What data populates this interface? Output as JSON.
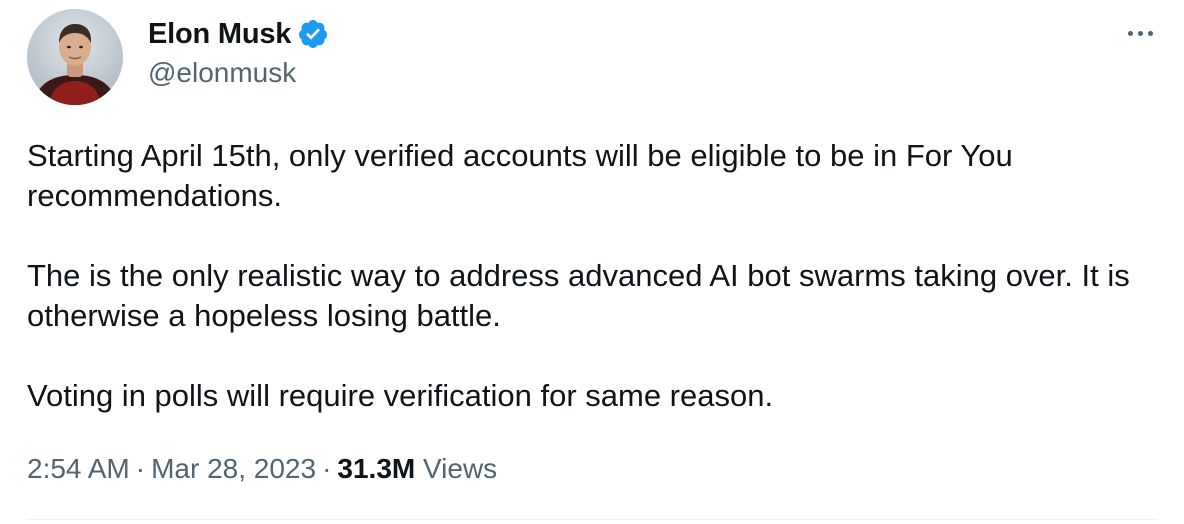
{
  "author": {
    "display_name": "Elon Musk",
    "handle": "@elonmusk",
    "verified": true,
    "badge_color": "#1d9bf0",
    "avatar_icon": "profile-photo"
  },
  "tweet": {
    "paragraphs": [
      "Starting April 15th, only verified accounts will be eligible to be in For You recommendations.",
      "The is the only realistic way to address advanced AI bot swarms taking over. It is otherwise a hopeless losing battle.",
      "Voting in polls will require verification for same reason."
    ],
    "time": "2:54 AM",
    "separator": "·",
    "date": "Mar 28, 2023",
    "views_count": "31.3M",
    "views_label": "Views"
  },
  "actions": {
    "more_icon": "more-horizontal-icon"
  },
  "colors": {
    "text_primary": "#0f1419",
    "text_secondary": "#536471",
    "divider": "#eff3f4"
  }
}
